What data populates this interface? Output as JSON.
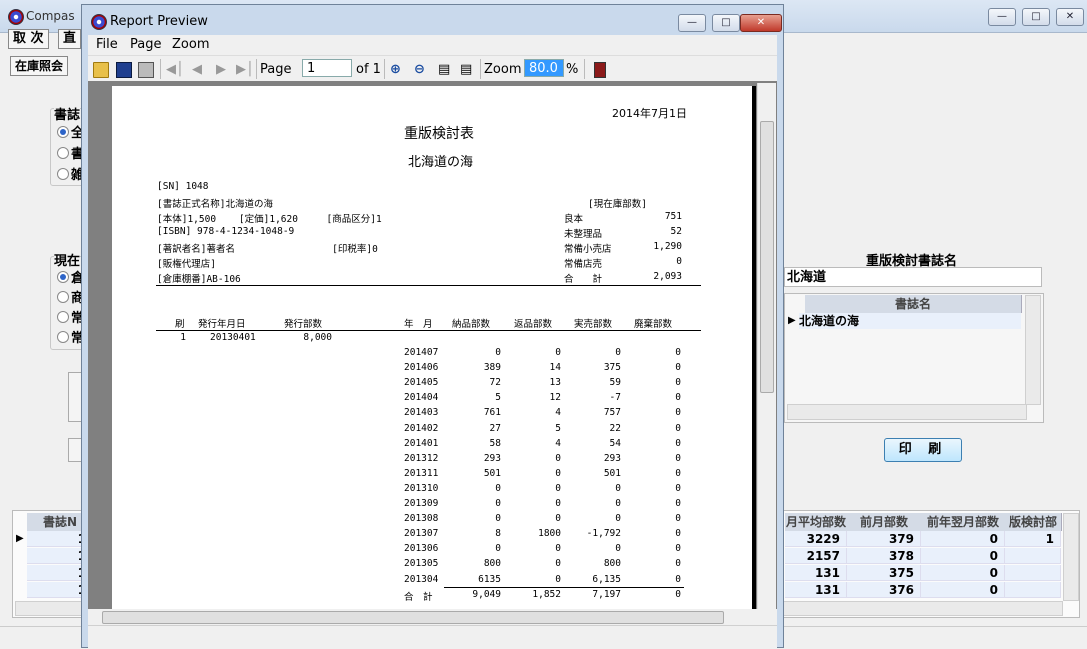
{
  "bg_app": {
    "title": "Compas",
    "menu_buttons": [
      "取 次",
      "直"
    ],
    "toolbar_button": "在庫照会",
    "group1_label": "書誌",
    "group1_radios": [
      "全",
      "書",
      "雑"
    ],
    "group2_label": "現在",
    "group2_radios": [
      "倉",
      "商",
      "常",
      "常"
    ],
    "right_panel": {
      "title_label": "重版検討書誌名",
      "title_value": "北海道",
      "grid_header": "書誌名",
      "grid_rows": [
        "北海道の海"
      ]
    },
    "print_button": "印 刷",
    "bottom_grid": {
      "left_header": "書誌N",
      "left_values": [
        "1",
        "1",
        "1",
        "1"
      ],
      "headers": [
        "月平均部数",
        "前月部数",
        "前年翌月部数",
        "版検討部数"
      ],
      "rows": [
        [
          "3229",
          "379",
          "0",
          "1"
        ],
        [
          "2157",
          "378",
          "0",
          ""
        ],
        [
          "131",
          "375",
          "0",
          ""
        ],
        [
          "131",
          "376",
          "0",
          ""
        ]
      ]
    }
  },
  "report_preview": {
    "title": "Report Preview",
    "menu": [
      "File",
      "Page",
      "Zoom"
    ],
    "toolbar": {
      "page_label": "Page",
      "page_value": "1",
      "of_label": "of 1",
      "zoom_label": "Zoom",
      "zoom_value": "80.0",
      "zoom_unit": "%"
    },
    "icons": [
      "folder-open-icon",
      "save-icon",
      "print-icon",
      "first-page-icon",
      "prev-page-icon",
      "next-page-icon",
      "last-page-icon",
      "zoom-in-icon",
      "zoom-out-icon",
      "fit-width-icon",
      "fit-page-icon",
      "exit-icon"
    ],
    "report": {
      "date": "2014年7月1日",
      "title": "重版検討表",
      "subtitle": "北海道の海",
      "info_left": [
        "[SN] 1048",
        "[書誌正式名称]北海道の海",
        "[本体]1,500    [定価]1,620     [商品区分]1",
        "[ISBN] 978-4-1234-1048-9",
        "[著訳者名]著者名                 [印税率]0",
        "[販権代理店]",
        "[倉庫棚番]AB-106"
      ],
      "stock_header": "[現在庫部数]",
      "stock": [
        {
          "label": "良本",
          "value": "751"
        },
        {
          "label": "未整理品",
          "value": "52"
        },
        {
          "label": "常備小売店",
          "value": "1,290"
        },
        {
          "label": "常備店売",
          "value": "0"
        },
        {
          "label": "合　　計",
          "value": "2,093"
        }
      ],
      "print_headers": [
        "刷",
        "発行年月日",
        "発行部数"
      ],
      "print_rows": [
        [
          "1",
          "20130401",
          "8,000"
        ]
      ],
      "month_headers": [
        "年　月",
        "納品部数",
        "返品部数",
        "実売部数",
        "廃棄部数"
      ],
      "month_rows": [
        [
          "201407",
          "0",
          "0",
          "0",
          "0"
        ],
        [
          "201406",
          "389",
          "14",
          "375",
          "0"
        ],
        [
          "201405",
          "72",
          "13",
          "59",
          "0"
        ],
        [
          "201404",
          "5",
          "12",
          "-7",
          "0"
        ],
        [
          "201403",
          "761",
          "4",
          "757",
          "0"
        ],
        [
          "201402",
          "27",
          "5",
          "22",
          "0"
        ],
        [
          "201401",
          "58",
          "4",
          "54",
          "0"
        ],
        [
          "201312",
          "293",
          "0",
          "293",
          "0"
        ],
        [
          "201311",
          "501",
          "0",
          "501",
          "0"
        ],
        [
          "201310",
          "0",
          "0",
          "0",
          "0"
        ],
        [
          "201309",
          "0",
          "0",
          "0",
          "0"
        ],
        [
          "201308",
          "0",
          "0",
          "0",
          "0"
        ],
        [
          "201307",
          "8",
          "1800",
          "-1,792",
          "0"
        ],
        [
          "201306",
          "0",
          "0",
          "0",
          "0"
        ],
        [
          "201305",
          "800",
          "0",
          "800",
          "0"
        ],
        [
          "201304",
          "6135",
          "0",
          "6,135",
          "0"
        ]
      ],
      "total_row": [
        "合　計",
        "9,049",
        "1,852",
        "7,197",
        "0"
      ]
    }
  }
}
